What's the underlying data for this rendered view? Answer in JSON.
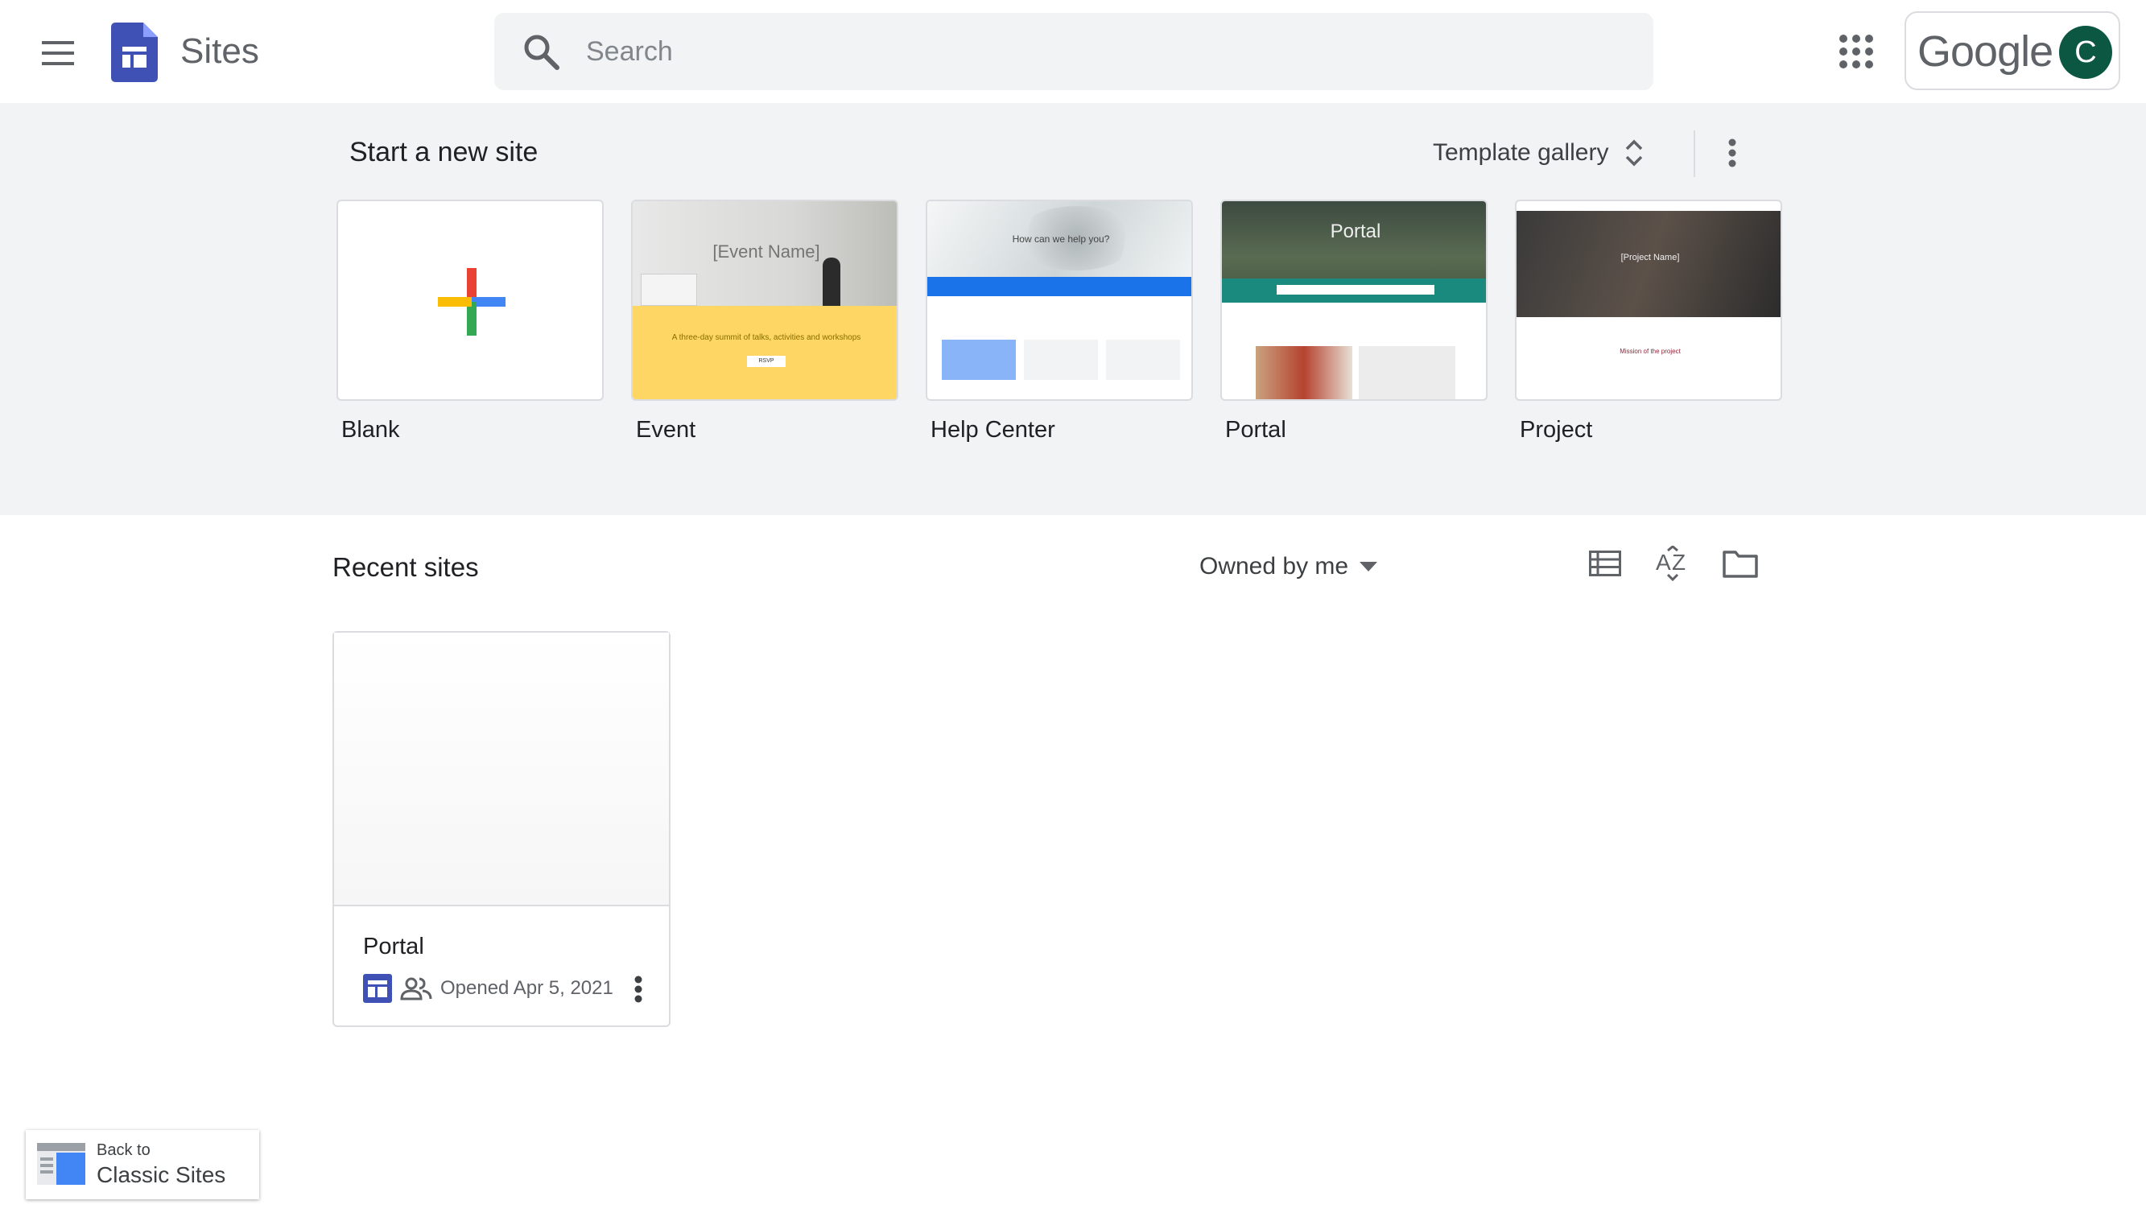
{
  "header": {
    "app_name": "Sites",
    "search_placeholder": "Search",
    "brand_word": "Google",
    "avatar_initial": "C"
  },
  "templates": {
    "title": "Start a new site",
    "gallery_label": "Template gallery",
    "items": [
      {
        "label": "Blank"
      },
      {
        "label": "Event",
        "thumb_title": "[Event Name]",
        "thumb_text": "A three-day summit of talks, activities and workshops",
        "thumb_button": "RSVP"
      },
      {
        "label": "Help Center",
        "thumb_title": "How can we help you?"
      },
      {
        "label": "Portal",
        "thumb_title": "Portal"
      },
      {
        "label": "Project",
        "thumb_title": "[Project Name]",
        "thumb_text": "Mission of the project"
      }
    ]
  },
  "recent": {
    "title": "Recent sites",
    "filter_label": "Owned by me",
    "sites": [
      {
        "name": "Portal",
        "opened": "Opened Apr 5, 2021"
      }
    ]
  },
  "classic": {
    "line1": "Back to",
    "line2": "Classic Sites"
  },
  "colors": {
    "brand_blue": "#3f51b5",
    "avatar_bg": "#0b5742",
    "band_bg": "#f1f3f4"
  },
  "icons": [
    "menu-icon",
    "sites-logo-icon",
    "search-icon",
    "apps-grid-icon",
    "expand-icon",
    "more-vert-icon",
    "plus-icon",
    "list-view-icon",
    "sort-az-icon",
    "folder-icon",
    "arrow-drop-down-icon",
    "site-icon",
    "shared-icon"
  ]
}
